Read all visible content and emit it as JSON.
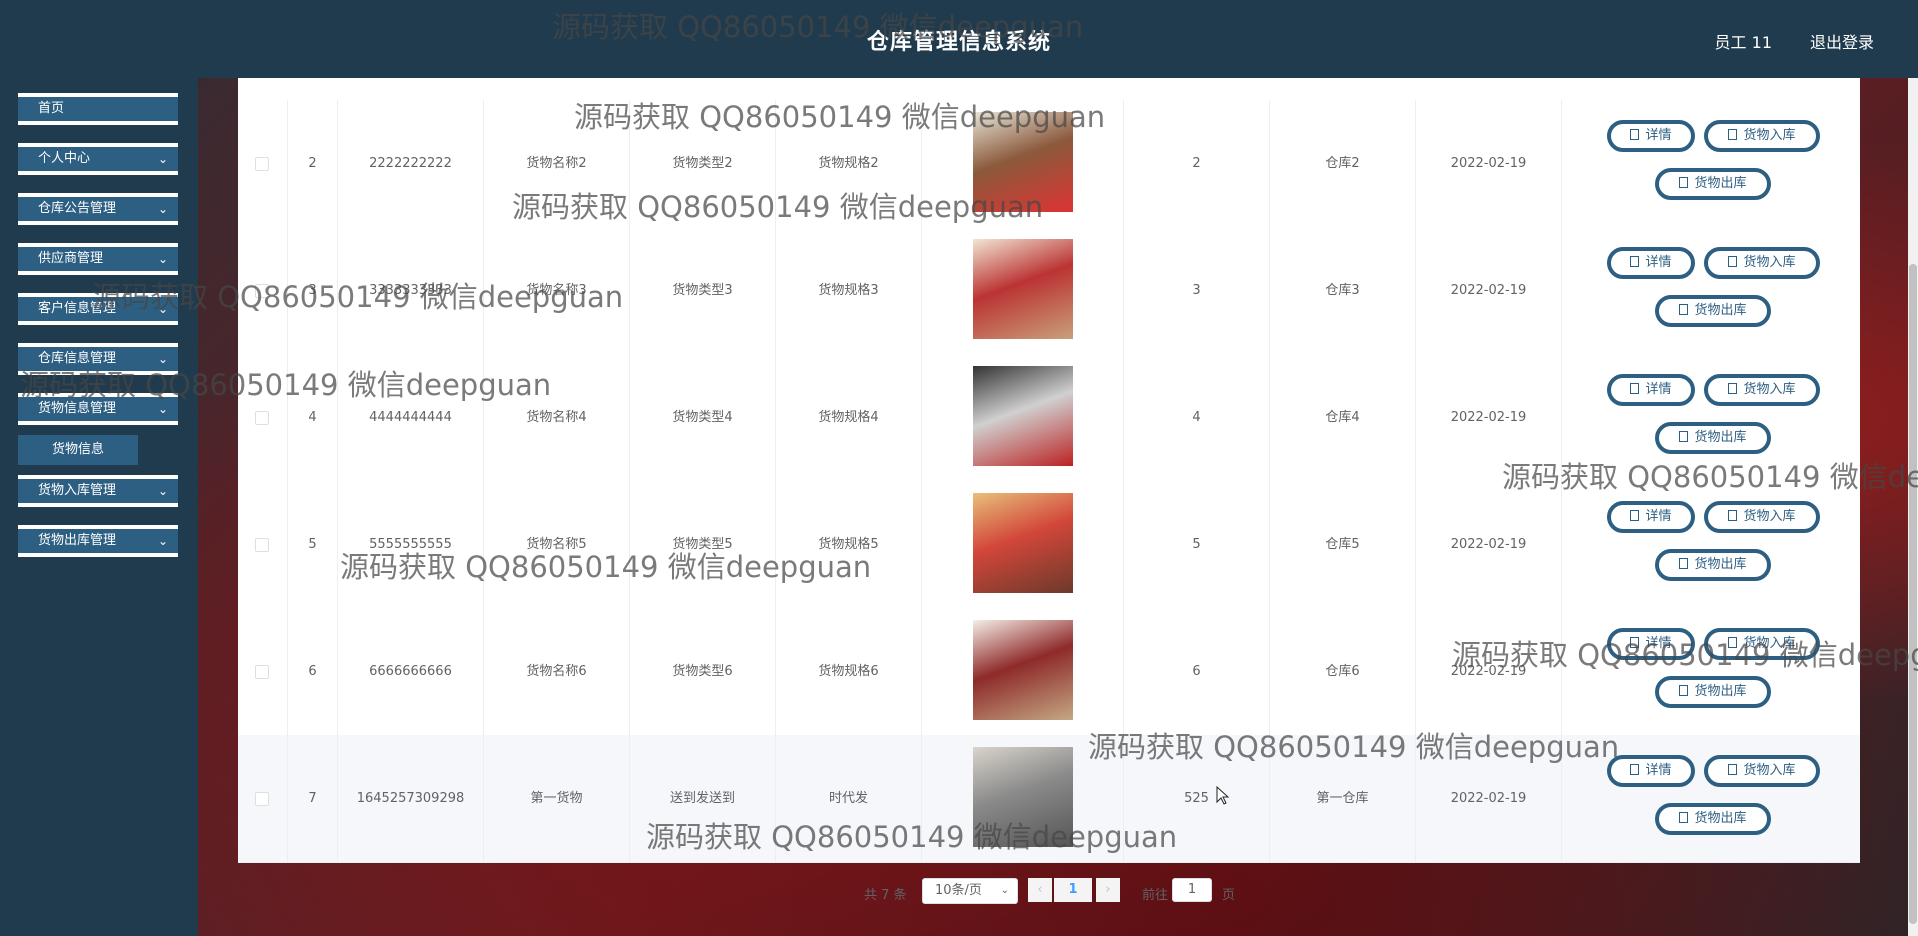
{
  "header": {
    "title": "仓库管理信息系统",
    "user": "员工 11",
    "logout": "退出登录"
  },
  "sidebar": {
    "items": [
      {
        "label": "首页",
        "chevron": false
      },
      {
        "label": "个人中心",
        "chevron": true
      },
      {
        "label": "仓库公告管理",
        "chevron": true
      },
      {
        "label": "供应商管理",
        "chevron": true
      },
      {
        "label": "客户信息管理",
        "chevron": true
      },
      {
        "label": "仓库信息管理",
        "chevron": true
      },
      {
        "label": "货物信息管理",
        "chevron": true
      },
      {
        "label": "货物入库管理",
        "chevron": true
      },
      {
        "label": "货物出库管理",
        "chevron": true
      }
    ],
    "sub_items": [
      {
        "label": "货物信息"
      }
    ]
  },
  "table": {
    "rows": [
      {
        "index": "2",
        "code": "2222222222",
        "name": "货物名称2",
        "type": "货物类型2",
        "spec": "货物规格2",
        "qty": "2",
        "warehouse": "仓库2",
        "date": "2022-02-19"
      },
      {
        "index": "3",
        "code": "3333333333",
        "name": "货物名称3",
        "type": "货物类型3",
        "spec": "货物规格3",
        "qty": "3",
        "warehouse": "仓库3",
        "date": "2022-02-19"
      },
      {
        "index": "4",
        "code": "4444444444",
        "name": "货物名称4",
        "type": "货物类型4",
        "spec": "货物规格4",
        "qty": "4",
        "warehouse": "仓库4",
        "date": "2022-02-19"
      },
      {
        "index": "5",
        "code": "5555555555",
        "name": "货物名称5",
        "type": "货物类型5",
        "spec": "货物规格5",
        "qty": "5",
        "warehouse": "仓库5",
        "date": "2022-02-19"
      },
      {
        "index": "6",
        "code": "6666666666",
        "name": "货物名称6",
        "type": "货物类型6",
        "spec": "货物规格6",
        "qty": "6",
        "warehouse": "仓库6",
        "date": "2022-02-19"
      },
      {
        "index": "7",
        "code": "1645257309298",
        "name": "第一货物",
        "type": "送到发送到",
        "spec": "时代发",
        "qty": "525",
        "warehouse": "第一仓库",
        "date": "2022-02-19"
      }
    ],
    "actions": {
      "detail": "详情",
      "stock_in": "货物入库",
      "stock_out": "货物出库"
    }
  },
  "pagination": {
    "total": "共 7 条",
    "page_size": "10条/页",
    "current_page": "1",
    "goto_label": "前往",
    "goto_value": "1",
    "page_unit": "页"
  },
  "watermark": "源码获取 QQ86050149 微信deepguan",
  "colors": {
    "header_bg": "#1f3b4d",
    "sidebar_bg": "#1f3b4d",
    "menu_bg": "#2d5f83",
    "button_border": "#2d5f83",
    "active_page": "#409eff"
  }
}
